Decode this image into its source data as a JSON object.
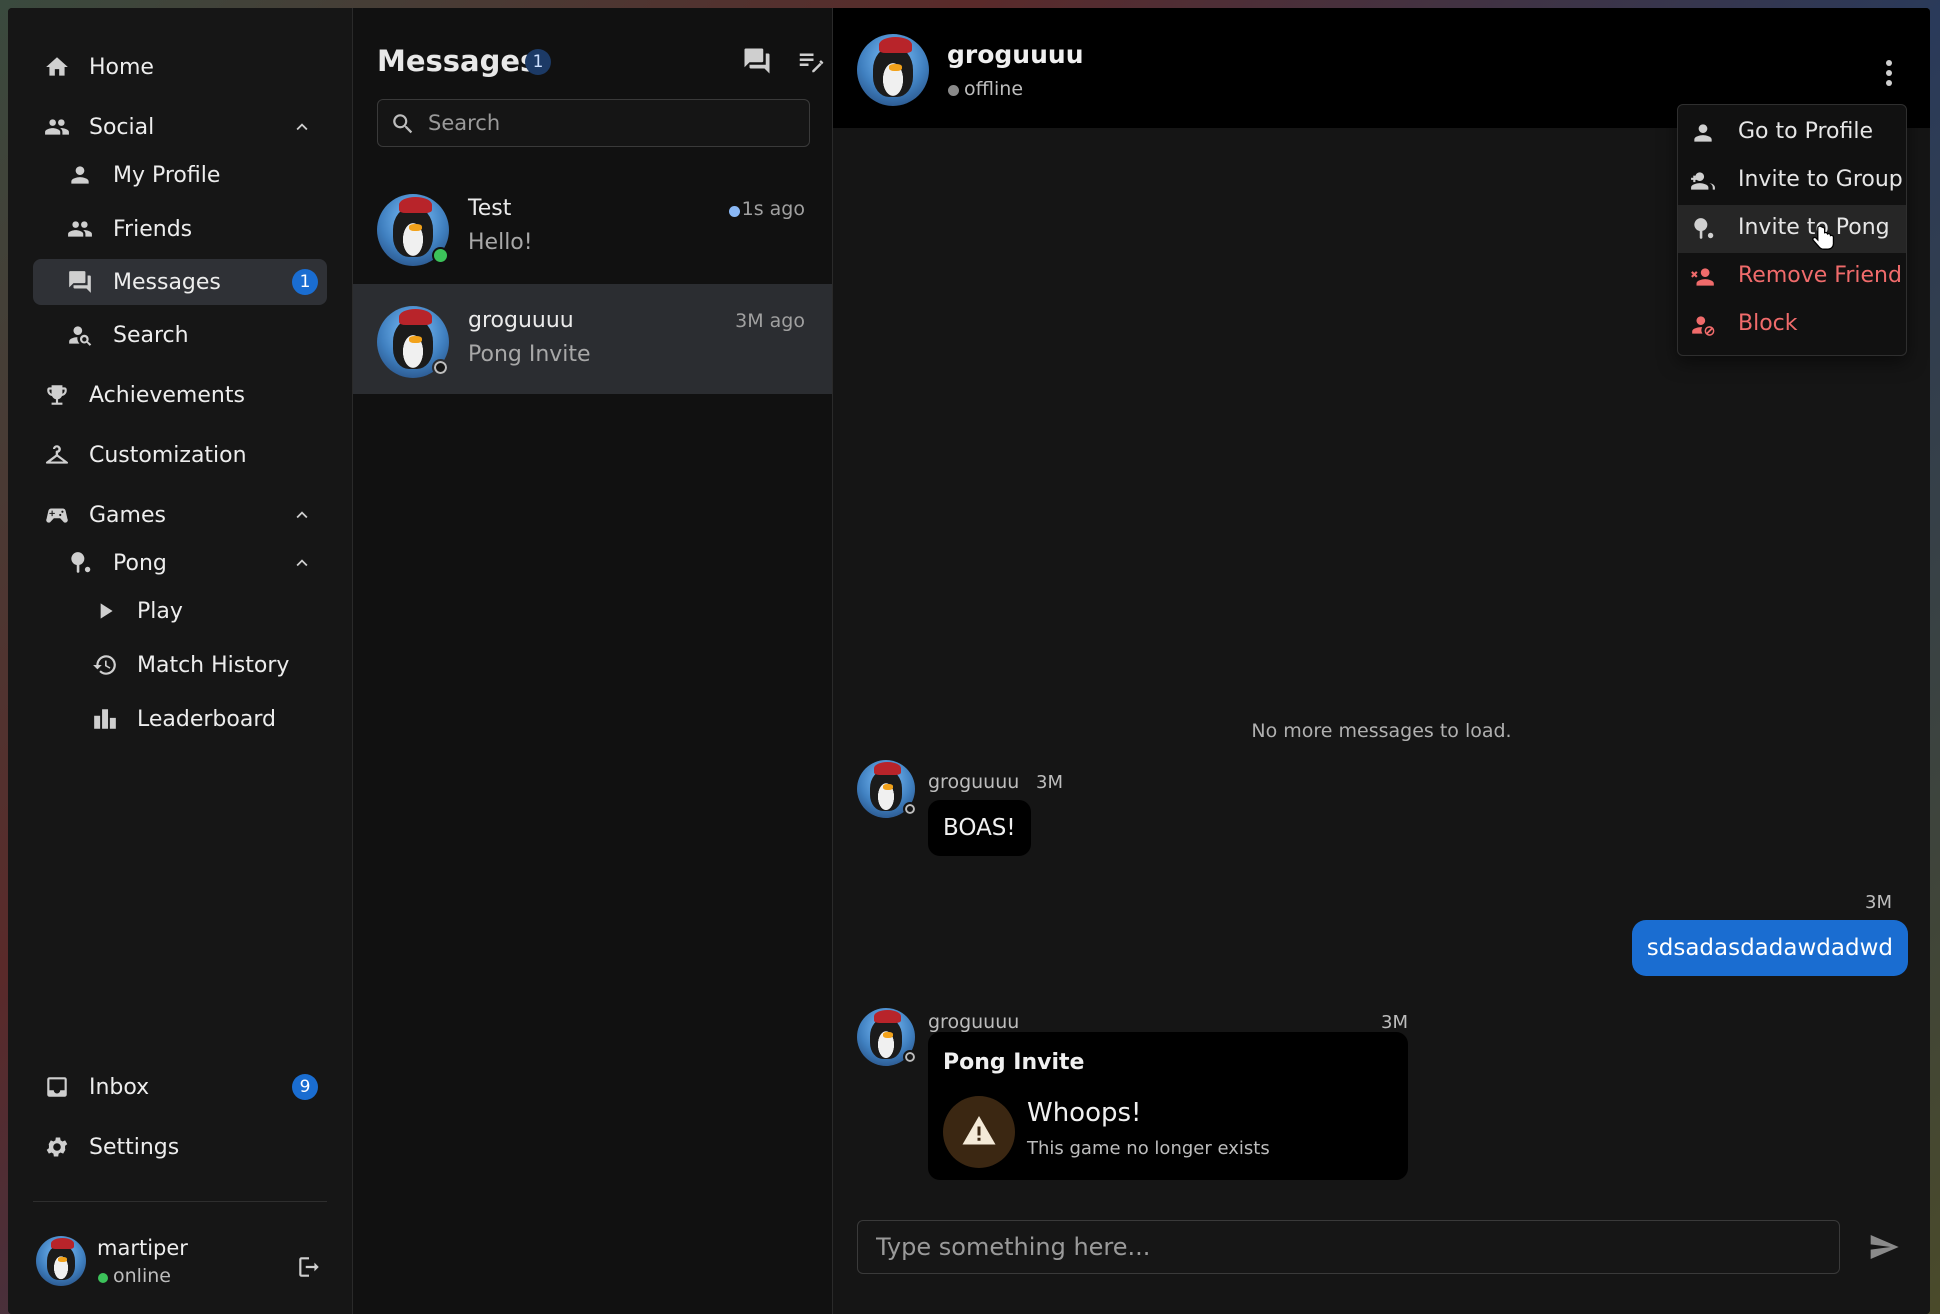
{
  "sidebar": {
    "home": "Home",
    "social": "Social",
    "my_profile": "My Profile",
    "friends": "Friends",
    "messages": "Messages",
    "messages_badge": "1",
    "search": "Search",
    "achievements": "Achievements",
    "customization": "Customization",
    "games": "Games",
    "pong": "Pong",
    "play": "Play",
    "match_history": "Match History",
    "leaderboard": "Leaderboard",
    "inbox": "Inbox",
    "inbox_badge": "9",
    "settings": "Settings",
    "user": {
      "name": "martiper",
      "status": "online"
    }
  },
  "messages_panel": {
    "title": "Messages",
    "badge": "1",
    "search_placeholder": "Search",
    "conversations": [
      {
        "name": "Test",
        "preview": "Hello!",
        "time": "1s ago",
        "unread": true,
        "status": "online"
      },
      {
        "name": "groguuuu",
        "preview": "Pong Invite",
        "time": "3M ago",
        "unread": false,
        "status": "offline",
        "selected": true
      }
    ]
  },
  "chat": {
    "name": "groguuuu",
    "status": "offline",
    "no_more": "No more messages to load.",
    "messages": [
      {
        "author": "groguuuu",
        "time": "3M",
        "text": "BOAS!"
      },
      {
        "time": "3M",
        "text": "sdsadasdadawdadwd"
      },
      {
        "author": "groguuuu",
        "time": "3M",
        "invite_title": "Pong Invite",
        "invite_heading": "Whoops!",
        "invite_sub": "This game no longer exists"
      }
    ],
    "composer_placeholder": "Type something here..."
  },
  "menu": {
    "items": [
      {
        "label": "Go to Profile"
      },
      {
        "label": "Invite to Group"
      },
      {
        "label": "Invite to Pong"
      },
      {
        "label": "Remove Friend"
      },
      {
        "label": "Block"
      }
    ]
  },
  "colors": {
    "accent": "#1a6dd1",
    "danger": "#f06b6b",
    "online": "#3cc25a"
  }
}
